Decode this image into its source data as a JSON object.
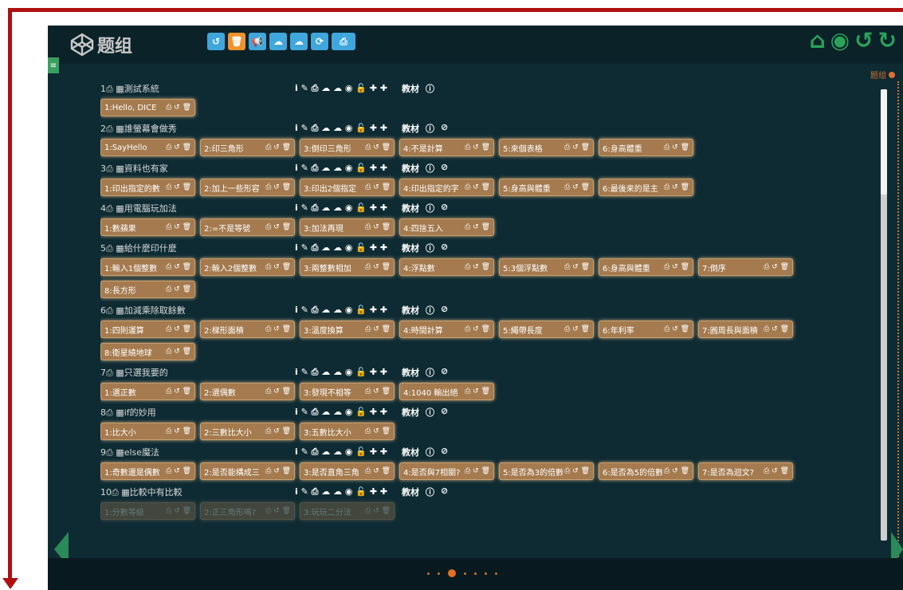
{
  "app": {
    "title": "题组"
  },
  "toolbar": {
    "buttons": [
      {
        "icon": "undo-icon",
        "glyph": "↺",
        "color": "#3fa7db"
      },
      {
        "icon": "trash-icon",
        "glyph": "🗑",
        "color": "#f0922e"
      },
      {
        "icon": "megaphone-icon",
        "glyph": "📢",
        "color": "#3fa7db"
      },
      {
        "icon": "cloud-upload-icon",
        "glyph": "☁",
        "color": "#3fa7db"
      },
      {
        "icon": "cloud-download-icon",
        "glyph": "☁",
        "color": "#3fa7db"
      },
      {
        "icon": "refresh-icon",
        "glyph": "⟳",
        "color": "#3fa7db"
      },
      {
        "icon": "print-icon",
        "glyph": "⎙",
        "color": "#3fa7db"
      }
    ]
  },
  "right_icons": [
    {
      "icon": "home-icon",
      "glyph": "⌂"
    },
    {
      "icon": "eye-icon",
      "glyph": "◉"
    },
    {
      "icon": "undo-icon",
      "glyph": "↺"
    },
    {
      "icon": "redo-icon",
      "glyph": "↻"
    }
  ],
  "side_label": "题组",
  "group_tools": "i ✎ ⎙ ☁ ☁ ◉ 🔓 ✚ ✚",
  "group_extra": {
    "label": "教材",
    "info": "ⓘ",
    "ban": "⊘"
  },
  "item_icons": "⎙ ↺ 🗑",
  "groups": [
    {
      "title": "1⎙ ▦測試系統",
      "show_ban": false,
      "items": [
        "1:Hello, DICE"
      ]
    },
    {
      "title": "2⎙ ▦誰螢幕會做秀",
      "show_ban": true,
      "items": [
        "1:SayHello",
        "2:印三角形",
        "3:倒印三角形",
        "4:不是計算",
        "5:來個表格",
        "6:身高體重"
      ]
    },
    {
      "title": "3⎙ ▦資料也有家",
      "show_ban": true,
      "items": [
        "1:印出指定的數",
        "2:加上一些形容",
        "3:印出2個指定",
        "4:印出指定的字",
        "5:身高與體重",
        "6:最後來的是主"
      ]
    },
    {
      "title": "4⎙ ▦用電腦玩加法",
      "show_ban": true,
      "items": [
        "1:數蘋果",
        "2:=不是等號",
        "3:加法再現",
        "4:四捨五入"
      ]
    },
    {
      "title": "5⎙ ▦給什麼印什麼",
      "show_ban": true,
      "items": [
        "1:輸入1個整數",
        "2:輸入2個整數",
        "3:兩整數相加",
        "4:浮點數",
        "5:3個浮點數",
        "6:身高與體重",
        "7:倒序",
        "8:長方形"
      ]
    },
    {
      "title": "6⎙ ▦加減乘除取餘數",
      "show_ban": true,
      "items": [
        "1:四則運算",
        "2:梯形面積",
        "3:溫度換算",
        "4:時間計算",
        "5:繩帶長度",
        "6:年利率",
        "7:圓周長與面積",
        "8:衛星繞地球"
      ]
    },
    {
      "title": "7⎙ ▦只選我要的",
      "show_ban": true,
      "items": [
        "1:選正數",
        "2:選偶數",
        "3:發現不相等",
        "4:1040 輸出絕"
      ]
    },
    {
      "title": "8⎙ ▦if的妙用",
      "show_ban": true,
      "items": [
        "1:比大小",
        "2:三數比大小",
        "3:五數比大小"
      ]
    },
    {
      "title": "9⎙ ▦else魔法",
      "show_ban": true,
      "items": [
        "1:奇數還是偶數",
        "2:是否能構成三",
        "3:是否直角三角",
        "4:是否與7相關?",
        "5:是否為3的倍數",
        "6:是否為5的倍數",
        "7:是否為迴文?"
      ]
    },
    {
      "title": "10⎙ ▦比較中有比較",
      "show_ban": true,
      "faded": true,
      "items": [
        "1:分數等級",
        "2:正三角形嗎?",
        "3:玩玩二分法"
      ]
    }
  ],
  "pager": {
    "count": 7,
    "active": 2
  },
  "scroll": {
    "position": 0
  }
}
